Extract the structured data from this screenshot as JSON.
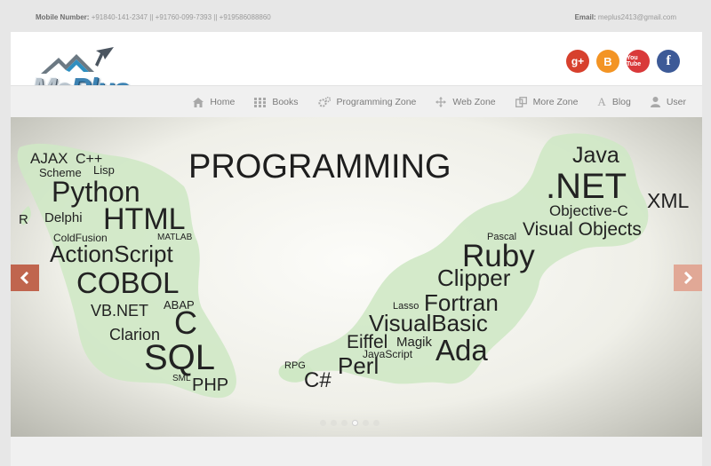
{
  "topbar": {
    "mobile_label": "Mobile Number:",
    "mobile_value": "+91840-141-2347 || +91760-099-7393 || +919586088860",
    "email_label": "Email:",
    "email_value": "meplus2413@gmail.com"
  },
  "logo": {
    "text_me": "Me",
    "text_plus": "Plus"
  },
  "social": {
    "gplus": "g+",
    "blogger": "B",
    "youtube": "You Tube",
    "facebook": "f"
  },
  "nav": {
    "items": [
      {
        "label": "Home",
        "icon": "home-icon"
      },
      {
        "label": "Books",
        "icon": "grid-icon"
      },
      {
        "label": "Programming Zone",
        "icon": "gears-icon"
      },
      {
        "label": "Web Zone",
        "icon": "arrows-move-icon"
      },
      {
        "label": "More Zone",
        "icon": "copy-icon"
      },
      {
        "label": "Blog",
        "icon": "font-icon"
      },
      {
        "label": "User",
        "icon": "user-icon"
      }
    ]
  },
  "slider": {
    "title": "PROGRAMMING",
    "words": [
      "AJAX",
      "C++",
      "Scheme",
      "Lisp",
      "Python",
      "R",
      "Delphi",
      "HTML",
      "ColdFusion",
      "MATLAB",
      "ActionScript",
      "COBOL",
      "VB.NET",
      "ABAP",
      "C",
      "Clarion",
      "SQL",
      "SML",
      "PHP",
      "Java",
      ".NET",
      "XML",
      "Objective-C",
      "Pascal",
      "Visual Objects",
      "Ruby",
      "Clipper",
      "Lasso",
      "Fortran",
      "VisualBasic",
      "Eiffel",
      "Magik",
      "JavaScript",
      "Ada",
      "RPG",
      "Perl",
      "C#"
    ],
    "active_slide": 3
  },
  "colors": {
    "accent_prev": "#c0654e",
    "accent_next": "#e1a896",
    "land": "#cfe8c5"
  }
}
